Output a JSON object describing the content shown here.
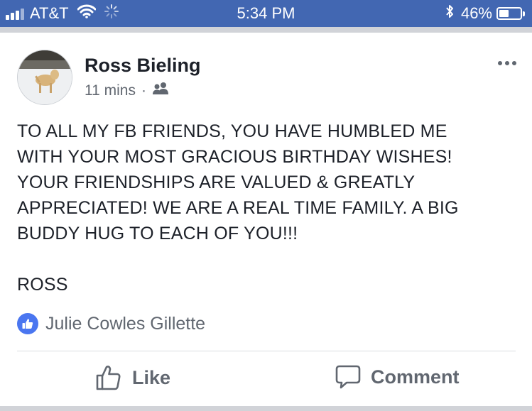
{
  "status_bar": {
    "carrier": "AT&T",
    "time": "5:34 PM",
    "battery_percent": "46%",
    "battery_level": 0.46
  },
  "post": {
    "author": "Ross Bieling",
    "timestamp": "11 mins",
    "separator": "·",
    "audience_icon": "friends-icon",
    "body": "TO ALL MY FB FRIENDS, YOU HAVE HUMBLED ME\nWITH YOUR MOST GRACIOUS BIRTHDAY WISHES!\nYOUR FRIENDSHIPS ARE VALUED & GREATLY\nAPPRECIATED! WE ARE A REAL TIME FAMILY. A BIG\nBUDDY HUG TO EACH OF YOU!!!\n\nROSS",
    "reactions": {
      "icon": "thumbs-up-icon",
      "names": "Julie Cowles Gillette"
    }
  },
  "actions": {
    "like_label": "Like",
    "comment_label": "Comment"
  },
  "colors": {
    "brand_blue": "#4267b2",
    "like_blue": "#4a76f0",
    "text_dark": "#1d2129",
    "text_muted": "#616770"
  }
}
